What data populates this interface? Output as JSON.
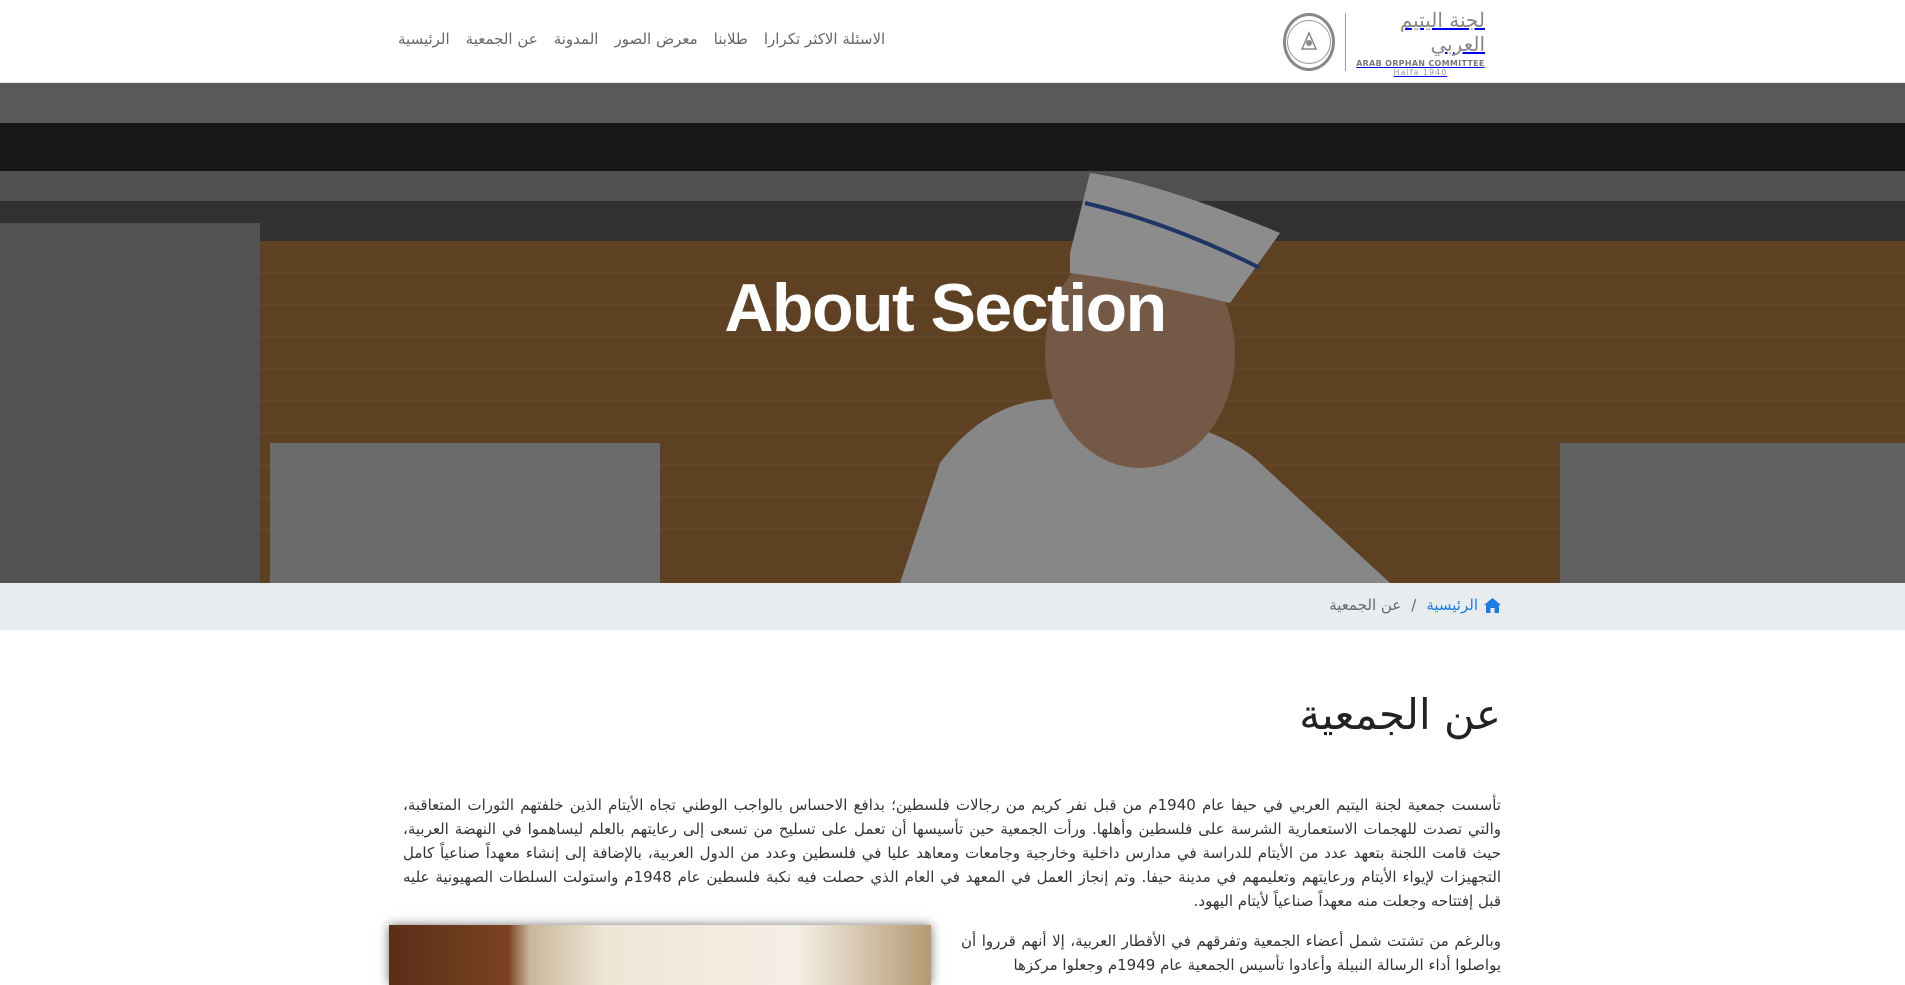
{
  "nav": {
    "links": [
      {
        "label": "الرئيسية"
      },
      {
        "label": "عن الجمعية"
      },
      {
        "label": "المدونة"
      },
      {
        "label": "معرض الصور"
      },
      {
        "label": "طلابنا"
      },
      {
        "label": "الاسئلة الاكثر تكرارا"
      }
    ]
  },
  "logo": {
    "arabic": "لجنة اليتيم العربي",
    "english": "ARAB ORPHAN COMMITTEE",
    "sub": "Haifa 1940"
  },
  "hero": {
    "title": "About Section"
  },
  "breadcrumb": {
    "home_label": "الرئيسية",
    "separator": "/",
    "current": "عن الجمعية"
  },
  "main": {
    "title": "عن الجمعية",
    "paragraph1": "تأسست جمعية لجنة اليتيم العربي في حيفا عام 1940م من قبل نفر كريم من رجالات فلسطين؛ بدافع الاحساس بالواجب الوطني تجاه الأيتام الذين خلفتهم الثورات المتعاقبة، والتي تصدت للهجمات الاستعمارية الشرسة على فلسطين وأهلها. ورأت الجمعية حين تأسيسها أن تعمل على تسليح من تسعى إلى رعايتهم بالعلم ليساهموا في النهضة العربية، حيث قامت اللجنة بتعهد عدد من الأيتام للدراسة في مدارس داخلية وخارجية وجامعات ومعاهد عليا في فلسطين وعدد من الدول العربية، بالإضافة إلى إنشاء معهداً صناعياً كامل التجهيزات لإيواء الأيتام ورعايتهم وتعليمهم في مدينة حيفا. وتم إنجاز العمل في المعهد في العام الذي حصلت فيه نكبة فلسطين عام 1948م واستولت السلطات الصهيونية عليه قبل إفتتاحه وجعلت منه معهداً صناعياً لأيتام اليهود.",
    "paragraph2": "وبالرغم من تشتت شمل أعضاء الجمعية وتفرقهم في الأقطار العربية، إلا أنهم قرروا أن يواصلوا أداء الرسالة النبيلة وأعادوا تأسيس الجمعية عام 1949م وجعلوا مركزها"
  },
  "colors": {
    "link_blue": "#1e7be0",
    "breadcrumb_bg": "#e9ecef",
    "nav_text": "#666666"
  },
  "icons": {
    "home": "home-icon"
  }
}
